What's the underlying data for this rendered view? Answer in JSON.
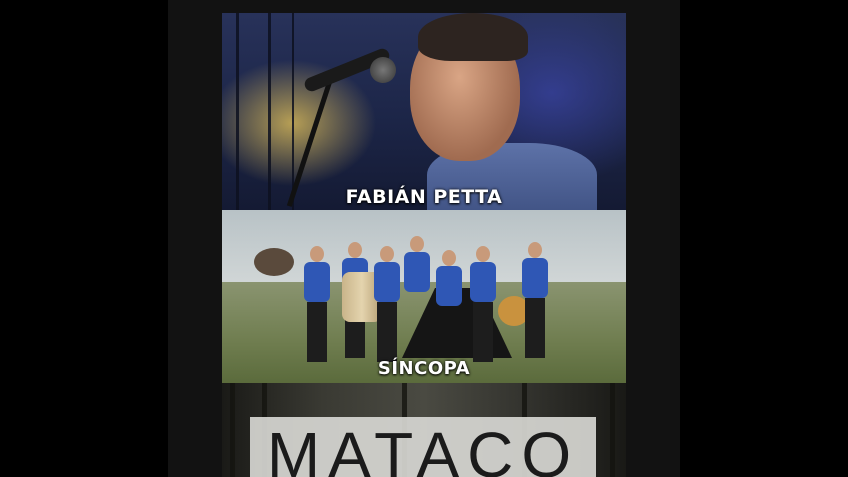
{
  "poster": {
    "panels": [
      {
        "name": "FABIÁN PETTA"
      },
      {
        "name": "SÍNCOPA"
      },
      {
        "name": "MATACO"
      }
    ]
  },
  "colors": {
    "side_background": "#000000",
    "column_background": "#121212",
    "vest_blue": "#2f57b5"
  }
}
